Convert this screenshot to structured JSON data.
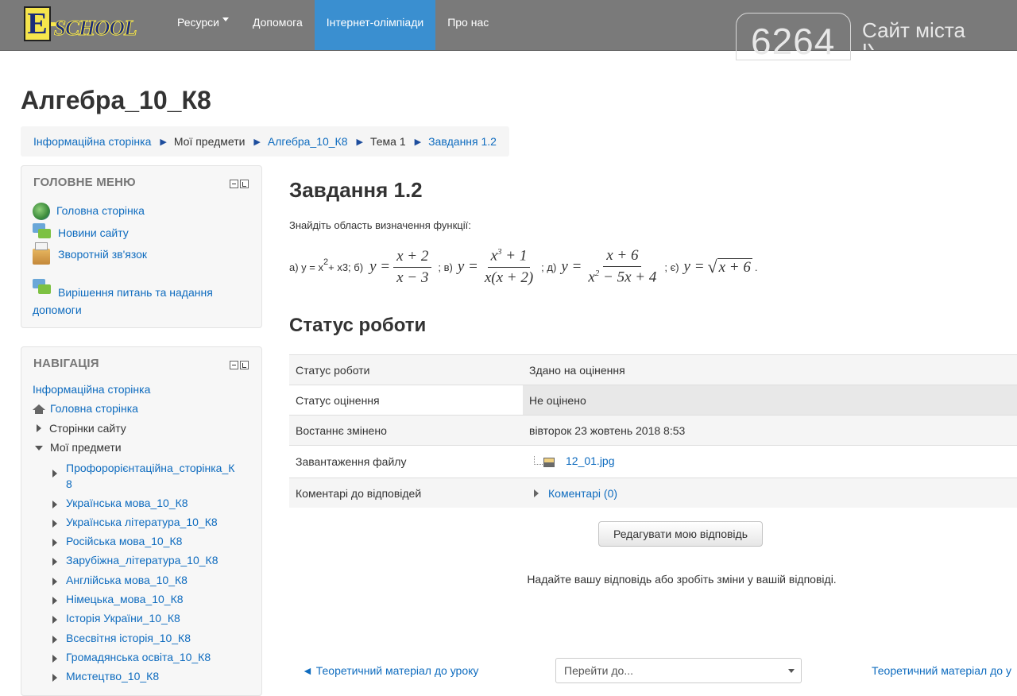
{
  "topbar": {
    "logo_letter": "E",
    "logo_word": "SCHOOL",
    "nav": [
      {
        "label": "Ресурси",
        "dropdown": true
      },
      {
        "label": "Допомога"
      },
      {
        "label": "Інтернет-олімпіади",
        "active": true
      },
      {
        "label": "Про нас"
      }
    ],
    "city_badge_number": "6264",
    "city_badge_text": "Сайт міста",
    "city_badge_text2": "К"
  },
  "page": {
    "title": "Алгебра_10_К8",
    "breadcrumb": [
      {
        "label": "Інформаційна сторінка",
        "link": true
      },
      {
        "label": "Мої предмети",
        "link": false
      },
      {
        "label": "Алгебра_10_К8",
        "link": true
      },
      {
        "label": "Тема 1",
        "link": false
      },
      {
        "label": "Завдання 1.2",
        "link": true
      }
    ]
  },
  "main_menu": {
    "title": "ГОЛОВНЕ МЕНЮ",
    "items": [
      {
        "label": "Головна сторінка",
        "icon": "globe-icon"
      },
      {
        "label": "Новини сайту",
        "icon": "chat-icon"
      },
      {
        "label": "Зворотній зв'язок",
        "icon": "box-icon"
      },
      {
        "label": "Вирішення питань та надання допомоги",
        "line1": "Вирішення питань та надання",
        "line2": "допомоги",
        "icon": "chat-icon"
      }
    ]
  },
  "navigation": {
    "title": "НАВІГАЦІЯ",
    "info_page": "Інформаційна сторінка",
    "home": "Головна сторінка",
    "site_pages": "Сторінки сайту",
    "my_courses": "Мої предмети",
    "subjects": [
      "Профорорієнтаційна_сторінка_К8",
      "Українська мова_10_К8",
      "Українська література_10_К8",
      "Російська мова_10_К8",
      "Зарубіжна_література_10_К8",
      "Англійська мова_10_К8",
      "Німецька_мова_10_К8",
      "Історія України_10_К8",
      "Всесвітня історія_10_К8",
      "Громадянська освіта_10_К8",
      "Мистецтво_10_К8"
    ],
    "subject0_line1": "Профорорієнтаційна_сторінка_К",
    "subject0_line2": "8"
  },
  "assignment": {
    "title": "Завдання 1.2",
    "task": "Знайдіть область визначення функції:",
    "math": {
      "a_prefix": "а) y = x",
      "a_exp": "2",
      "a_suffix": " + x3; б)",
      "b_num": "x + 2",
      "b_den": "x − 3",
      "v_label": "; в)",
      "v_num_base": "x",
      "v_num_exp": "3",
      "v_num_rest": " + 1",
      "v_den": "x(x + 2)",
      "d_label": "; д)",
      "d_num": "x + 6",
      "d_den_base": "x",
      "d_den_exp": "2",
      "d_den_rest": " − 5x + 4",
      "e_label": "; є)",
      "e_rad": "x + 6",
      "y_eq": "y =",
      "end": "."
    }
  },
  "status": {
    "title": "Статус роботи",
    "rows": [
      {
        "label": "Статус роботи",
        "value": "Здано на оцінення"
      },
      {
        "label": "Статус оцінення",
        "value": "Не оцінено"
      },
      {
        "label": "Востаннє змінено",
        "value": "вівторок 23 жовтень 2018 8:53"
      },
      {
        "label": "Завантаження файлу",
        "value": "12_01.jpg"
      },
      {
        "label": "Коментарі до відповідей",
        "value": "Коментарі (0)"
      }
    ],
    "edit_button": "Редагувати мою відповідь",
    "hint": "Надайте вашу відповідь або зробіть зміни у вашій відповіді."
  },
  "footer_nav": {
    "prev": "◄ Теоретичний матеріал до уроку",
    "jump_placeholder": "Перейти до...",
    "next": "Теоретичний матеріал до у"
  }
}
